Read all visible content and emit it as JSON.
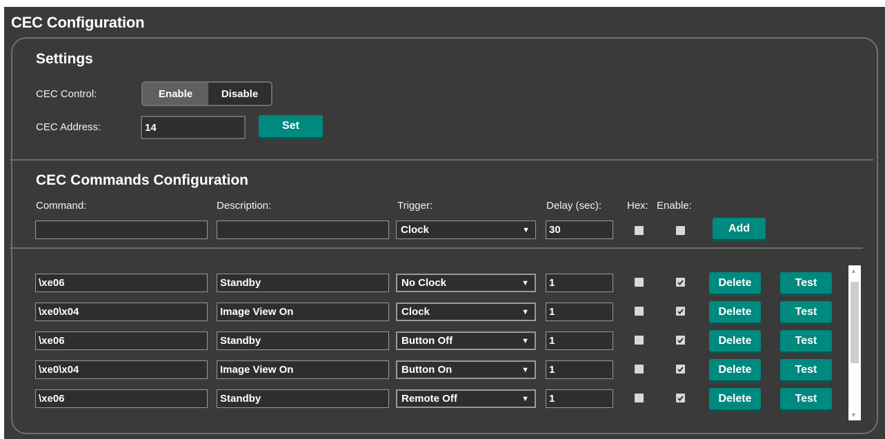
{
  "page": {
    "title": "CEC Configuration"
  },
  "settings": {
    "title": "Settings",
    "cec_control": {
      "label": "CEC Control:",
      "enable": "Enable",
      "disable": "Disable",
      "selected": "Enable"
    },
    "cec_address": {
      "label": "CEC Address:",
      "value": "14",
      "set_label": "Set"
    }
  },
  "commands": {
    "title": "CEC Commands Configuration",
    "headers": {
      "command": "Command:",
      "description": "Description:",
      "trigger": "Trigger:",
      "delay": "Delay (sec):",
      "hex": "Hex:",
      "enable": "Enable:"
    },
    "new_entry": {
      "command": "",
      "description": "",
      "trigger": "Clock",
      "delay": "30",
      "hex": false,
      "enable": false,
      "add_label": "Add"
    },
    "row_actions": {
      "delete": "Delete",
      "test": "Test"
    },
    "rows": [
      {
        "command": "\\xe06",
        "description": "Standby",
        "trigger": "No Clock",
        "delay": "1",
        "hex": false,
        "enable": true
      },
      {
        "command": "\\xe0\\x04",
        "description": "Image View On",
        "trigger": "Clock",
        "delay": "1",
        "hex": false,
        "enable": true
      },
      {
        "command": "\\xe06",
        "description": "Standby",
        "trigger": "Button Off",
        "delay": "1",
        "hex": false,
        "enable": true
      },
      {
        "command": "\\xe0\\x04",
        "description": "Image View On",
        "trigger": "Button On",
        "delay": "1",
        "hex": false,
        "enable": true
      },
      {
        "command": "\\xe06",
        "description": "Standby",
        "trigger": "Remote Off",
        "delay": "1",
        "hex": false,
        "enable": true
      }
    ]
  },
  "icons": {
    "dropdown": "dropdown-arrow-icon",
    "check": "checkmark-icon",
    "scroll_up": "scroll-up-icon",
    "scroll_down": "scroll-down-icon"
  },
  "colors": {
    "accent": "#00897e",
    "background": "#3a3a3a",
    "border": "#6f6f6f"
  }
}
